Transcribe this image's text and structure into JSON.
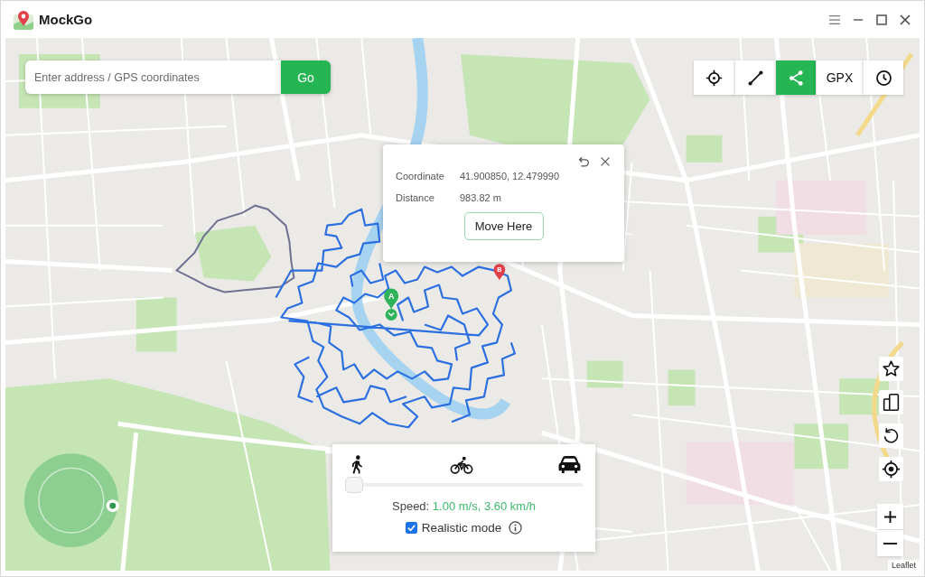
{
  "window": {
    "title": "MockGo"
  },
  "search": {
    "placeholder": "Enter address / GPS coordinates",
    "button": "Go"
  },
  "toolbar": [
    {
      "kind": "crosshair",
      "selected": false
    },
    {
      "kind": "route",
      "selected": false
    },
    {
      "kind": "share",
      "selected": true
    },
    {
      "kind": "text",
      "label": "GPX",
      "selected": false
    },
    {
      "kind": "clock",
      "selected": false
    }
  ],
  "markers": [
    {
      "kind": "start",
      "label": "A",
      "color": "#2fb35a"
    },
    {
      "kind": "end",
      "label": "B",
      "color": "#e2414b"
    }
  ],
  "popup": {
    "rows": [
      {
        "label": "Coordinate",
        "value": "41.900850, 12.479990"
      },
      {
        "label": "Distance",
        "value": "983.82 m"
      }
    ],
    "button": "Move Here"
  },
  "speed_panel": {
    "level": 0,
    "label": "Speed:",
    "value": "1.00 m/s, 3.60 km/h",
    "realistic": {
      "label": "Realistic mode",
      "checked": true
    }
  },
  "map": {
    "attribution": "Leaflet"
  }
}
